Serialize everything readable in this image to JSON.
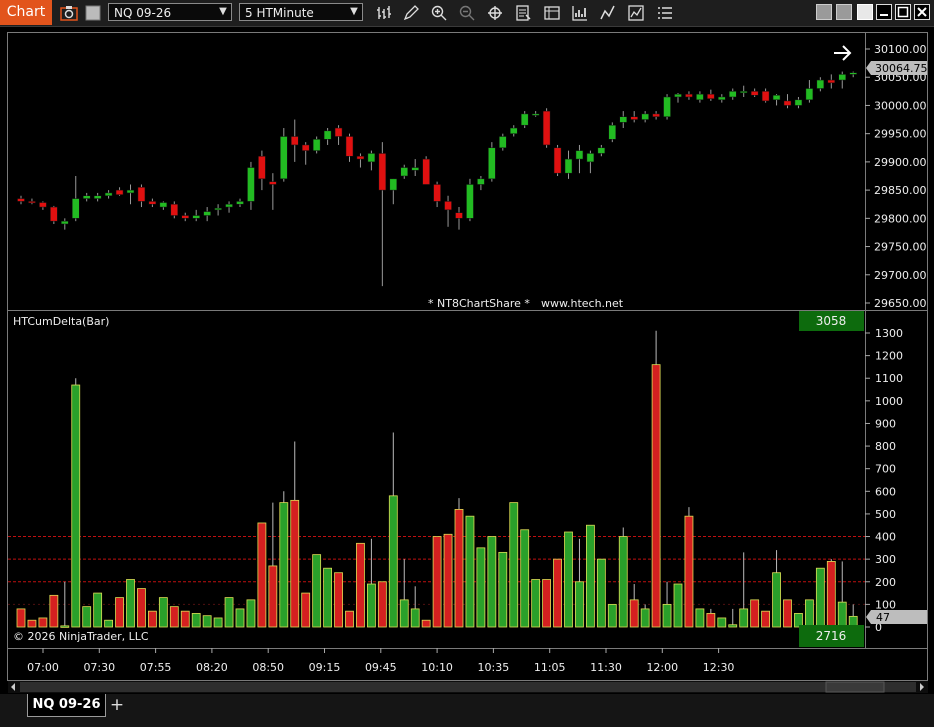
{
  "toolbar": {
    "app_label": "Chart",
    "instrument": "NQ 09-26",
    "interval": "5 HTMinute",
    "icons": [
      "camera-icon",
      "bar-style-icon",
      "pencil-draw-icon",
      "zoom-in-icon",
      "zoom-out-icon",
      "crosshair-icon",
      "properties-icon",
      "data-box-icon",
      "performance-icon",
      "strategy-icon",
      "indicators-icon",
      "list-icon"
    ]
  },
  "price_panel": {
    "watermark": "* NT8ChartShare *",
    "website": "www.htech.net",
    "last_price": "30064.75",
    "axis_labels": [
      "30100.00",
      "30050.00",
      "30000.00",
      "29950.00",
      "29900.00",
      "29850.00",
      "29800.00",
      "29750.00",
      "29700.00",
      "29650.00"
    ],
    "up_color": "#22bb22",
    "down_color": "#e01010"
  },
  "indicator_panel": {
    "title": "HTCumDelta(Bar)",
    "top_badge": "3058",
    "bottom_badge": "2716",
    "last_value": "47",
    "copyright": "© 2026 NinjaTrader, LLC",
    "axis_labels": [
      "1300",
      "1200",
      "1100",
      "1000",
      "900",
      "800",
      "700",
      "600",
      "500",
      "400",
      "300",
      "200",
      "100",
      "0"
    ],
    "ref_lines": [
      400,
      300,
      200
    ]
  },
  "time_axis": [
    "07:00",
    "07:30",
    "07:55",
    "08:20",
    "08:50",
    "09:15",
    "09:45",
    "10:10",
    "10:35",
    "11:05",
    "11:30",
    "12:00",
    "12:30"
  ],
  "chart_data": {
    "type": "candlestick",
    "price_ohlc": [
      [
        29835,
        29840,
        29825,
        29830
      ],
      [
        29830,
        29835,
        29825,
        29828
      ],
      [
        29828,
        29830,
        29815,
        29820
      ],
      [
        29820,
        29822,
        29790,
        29795
      ],
      [
        29790,
        29800,
        29780,
        29795
      ],
      [
        29800,
        29875,
        29795,
        29835
      ],
      [
        29835,
        29845,
        29830,
        29840
      ],
      [
        29835,
        29845,
        29830,
        29840
      ],
      [
        29840,
        29850,
        29835,
        29845
      ],
      [
        29850,
        29855,
        29840,
        29842
      ],
      [
        29845,
        29860,
        29825,
        29850
      ],
      [
        29855,
        29860,
        29820,
        29830
      ],
      [
        29830,
        29835,
        29820,
        29825
      ],
      [
        29820,
        29830,
        29815,
        29828
      ],
      [
        29825,
        29830,
        29800,
        29805
      ],
      [
        29805,
        29810,
        29795,
        29800
      ],
      [
        29800,
        29815,
        29795,
        29805
      ],
      [
        29805,
        29820,
        29795,
        29812
      ],
      [
        29815,
        29825,
        29805,
        29818
      ],
      [
        29820,
        29830,
        29810,
        29825
      ],
      [
        29825,
        29835,
        29820,
        29830
      ],
      [
        29830,
        29900,
        29815,
        29890
      ],
      [
        29910,
        29920,
        29850,
        29870
      ],
      [
        29865,
        29880,
        29815,
        29860
      ],
      [
        29870,
        29960,
        29865,
        29945
      ],
      [
        29945,
        29975,
        29900,
        29930
      ],
      [
        29930,
        29935,
        29895,
        29920
      ],
      [
        29920,
        29945,
        29915,
        29940
      ],
      [
        29940,
        29960,
        29930,
        29955
      ],
      [
        29960,
        29965,
        29930,
        29945
      ],
      [
        29945,
        29950,
        29900,
        29910
      ],
      [
        29910,
        29915,
        29890,
        29905
      ],
      [
        29900,
        29920,
        29885,
        29915
      ],
      [
        29915,
        29935,
        29680,
        29850
      ],
      [
        29850,
        29870,
        29825,
        29870
      ],
      [
        29875,
        29895,
        29870,
        29890
      ],
      [
        29885,
        29905,
        29875,
        29890
      ],
      [
        29905,
        29910,
        29860,
        29860
      ],
      [
        29860,
        29865,
        29820,
        29830
      ],
      [
        29830,
        29840,
        29785,
        29815
      ],
      [
        29810,
        29820,
        29780,
        29800
      ],
      [
        29800,
        29870,
        29795,
        29860
      ],
      [
        29860,
        29875,
        29850,
        29870
      ],
      [
        29870,
        29935,
        29865,
        29925
      ],
      [
        29925,
        29950,
        29920,
        29945
      ],
      [
        29950,
        29965,
        29945,
        29960
      ],
      [
        29965,
        29990,
        29960,
        29985
      ],
      [
        29985,
        29990,
        29980,
        29985
      ],
      [
        29990,
        29995,
        29925,
        29930
      ],
      [
        29925,
        29930,
        29875,
        29880
      ],
      [
        29880,
        29920,
        29870,
        29905
      ],
      [
        29905,
        29930,
        29880,
        29920
      ],
      [
        29900,
        29920,
        29880,
        29915
      ],
      [
        29915,
        29930,
        29910,
        29925
      ],
      [
        29940,
        29970,
        29935,
        29965
      ],
      [
        29970,
        29990,
        29960,
        29980
      ],
      [
        29980,
        29990,
        29970,
        29975
      ],
      [
        29975,
        29990,
        29970,
        29985
      ],
      [
        29985,
        29990,
        29975,
        29980
      ],
      [
        29980,
        30020,
        29975,
        30015
      ],
      [
        30015,
        30022,
        30005,
        30020
      ],
      [
        30020,
        30025,
        30010,
        30015
      ],
      [
        30010,
        30025,
        30005,
        30020
      ],
      [
        30020,
        30028,
        30008,
        30012
      ],
      [
        30010,
        30020,
        30005,
        30015
      ],
      [
        30015,
        30030,
        30010,
        30025
      ],
      [
        30025,
        30035,
        30015,
        30025
      ],
      [
        30025,
        30030,
        30015,
        30018
      ],
      [
        30025,
        30030,
        30005,
        30008
      ],
      [
        30010,
        30020,
        30000,
        30018
      ],
      [
        30008,
        30020,
        29995,
        30000
      ],
      [
        30000,
        30015,
        29995,
        30010
      ],
      [
        30010,
        30045,
        30005,
        30030
      ],
      [
        30030,
        30050,
        30025,
        30045
      ],
      [
        30045,
        30055,
        30030,
        30040
      ],
      [
        30045,
        30060,
        30030,
        30055
      ],
      [
        30055,
        30060,
        30050,
        30058
      ]
    ],
    "cum_delta": [
      [
        0,
        80,
        0,
        80
      ],
      [
        0,
        30,
        0,
        30
      ],
      [
        0,
        40,
        0,
        40
      ],
      [
        0,
        140,
        0,
        140
      ],
      [
        0,
        200,
        0,
        5
      ],
      [
        0,
        1100,
        0,
        1070
      ],
      [
        0,
        90,
        0,
        90
      ],
      [
        0,
        150,
        0,
        150
      ],
      [
        0,
        30,
        0,
        30
      ],
      [
        0,
        130,
        0,
        130
      ],
      [
        0,
        210,
        0,
        210
      ],
      [
        0,
        170,
        0,
        170
      ],
      [
        0,
        70,
        0,
        70
      ],
      [
        0,
        130,
        0,
        130
      ],
      [
        0,
        90,
        0,
        90
      ],
      [
        0,
        70,
        0,
        70
      ],
      [
        0,
        60,
        0,
        60
      ],
      [
        0,
        50,
        0,
        50
      ],
      [
        0,
        40,
        0,
        40
      ],
      [
        0,
        130,
        0,
        130
      ],
      [
        0,
        80,
        0,
        80
      ],
      [
        0,
        120,
        0,
        120
      ],
      [
        0,
        460,
        0,
        460
      ],
      [
        0,
        550,
        0,
        270
      ],
      [
        0,
        600,
        0,
        550
      ],
      [
        0,
        820,
        0,
        560
      ],
      [
        0,
        150,
        0,
        150
      ],
      [
        0,
        320,
        0,
        320
      ],
      [
        0,
        260,
        0,
        260
      ],
      [
        0,
        240,
        0,
        240
      ],
      [
        0,
        70,
        0,
        70
      ],
      [
        0,
        370,
        0,
        370
      ],
      [
        0,
        390,
        0,
        190
      ],
      [
        0,
        200,
        0,
        200
      ],
      [
        0,
        860,
        0,
        580
      ],
      [
        0,
        300,
        0,
        120
      ],
      [
        0,
        180,
        0,
        80
      ],
      [
        0,
        30,
        0,
        30
      ],
      [
        0,
        400,
        0,
        400
      ],
      [
        0,
        410,
        0,
        410
      ],
      [
        0,
        570,
        0,
        520
      ],
      [
        0,
        490,
        0,
        490
      ],
      [
        0,
        350,
        0,
        350
      ],
      [
        0,
        400,
        0,
        400
      ],
      [
        0,
        330,
        0,
        330
      ],
      [
        0,
        550,
        0,
        550
      ],
      [
        0,
        430,
        0,
        430
      ],
      [
        0,
        210,
        0,
        210
      ],
      [
        0,
        210,
        0,
        210
      ],
      [
        0,
        300,
        0,
        300
      ],
      [
        0,
        420,
        0,
        420
      ],
      [
        0,
        390,
        0,
        200
      ],
      [
        0,
        450,
        0,
        450
      ],
      [
        0,
        300,
        0,
        300
      ],
      [
        0,
        100,
        0,
        100
      ],
      [
        0,
        440,
        0,
        400
      ],
      [
        0,
        190,
        0,
        120
      ],
      [
        0,
        100,
        0,
        80
      ],
      [
        0,
        1310,
        0,
        1160
      ],
      [
        0,
        200,
        0,
        100
      ],
      [
        0,
        190,
        0,
        190
      ],
      [
        0,
        530,
        0,
        490
      ],
      [
        0,
        80,
        0,
        80
      ],
      [
        0,
        80,
        0,
        60
      ],
      [
        0,
        40,
        0,
        40
      ],
      [
        0,
        80,
        0,
        10
      ],
      [
        0,
        330,
        0,
        80
      ],
      [
        0,
        120,
        0,
        120
      ],
      [
        0,
        70,
        0,
        70
      ],
      [
        0,
        340,
        0,
        240
      ],
      [
        0,
        120,
        0,
        120
      ],
      [
        0,
        60,
        0,
        60
      ],
      [
        0,
        120,
        0,
        120
      ],
      [
        0,
        260,
        0,
        260
      ],
      [
        0,
        300,
        0,
        290
      ],
      [
        0,
        290,
        0,
        110
      ],
      [
        0,
        100,
        0,
        47
      ]
    ],
    "cum_delta_colors": "mostly green with red for down bars"
  }
}
